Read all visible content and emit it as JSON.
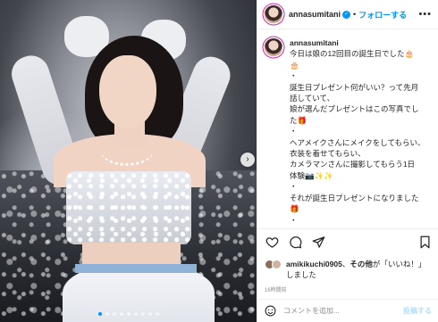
{
  "post": {
    "username": "annasumitani",
    "separator": "•",
    "follow_label": "フォローする",
    "more_label": "•••",
    "caption_lines": [
      "今日は娘の12回目の誕生日でした🎂",
      "🎂",
      "・",
      "誕生日プレゼント何がいい？って先月",
      "話していて、",
      "娘が選んだプレゼントはこの写真でし",
      "た🎁",
      "・",
      "ヘアメイクさんにメイクをしてもらい、",
      "衣装を着せてもらい、",
      "カメラマンさんに撮影してもらう1日",
      "体験📷✨✨",
      "・",
      "それが誕生日プレゼントになりました",
      "🎁",
      "・",
      "・"
    ]
  },
  "likes": {
    "liker": "amikikuchi0905",
    "text_mid": "、",
    "others": "その他",
    "text_tail": "が「いいね！」",
    "text_end": "しました"
  },
  "time_label": "16時間前",
  "comment": {
    "placeholder": "コメントを追加...",
    "post_label": "投稿する"
  },
  "carousel": {
    "dots": 9,
    "active_index": 0
  },
  "colors": {
    "accent": "#0095f6",
    "verified": "#0095f6"
  },
  "icons": [
    "verified-icon",
    "heart-icon",
    "comment-icon",
    "share-icon",
    "bookmark-icon",
    "emoji-icon",
    "chevron-right-icon"
  ]
}
